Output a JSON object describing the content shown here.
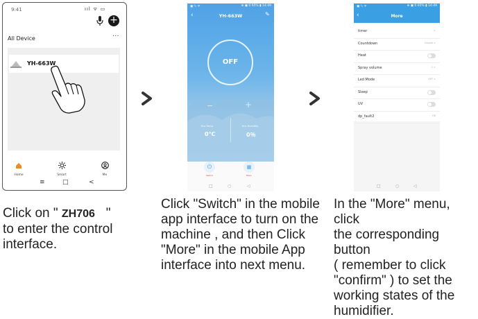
{
  "phone1": {
    "time": "9:41",
    "signal": "ııl ᯤ ▭",
    "header": "All Device",
    "more_dots": "···",
    "device_name": "YH-663W",
    "nav": [
      "Home",
      "Smart",
      "Me"
    ],
    "sysnav": [
      "≡",
      "□",
      "<"
    ]
  },
  "phone2": {
    "status_left": "▣ ⁰ᵢₗ ᯤ",
    "status_right": "⊛ ▣ 0 65% ▮ 14:49",
    "title": "YH-663W",
    "power_state": "OFF",
    "minus": "−",
    "plus": "+",
    "env_temp_label": "Env Temp",
    "env_temp_value": "0℃",
    "env_humidity_label": "Env Humidity",
    "env_humidity_value": "0％",
    "switch_label": "Switch",
    "more_label": "More",
    "sysnav": [
      "□",
      "○",
      "◁"
    ]
  },
  "phone3": {
    "status_left": "▣ ⁰ᵢₗ ᯤ",
    "status_right": "⊛ ▣ 0 65% ▮ 14:49",
    "title": "More",
    "rows": [
      {
        "label": "timer",
        "value": ">"
      },
      {
        "label": "Countdown",
        "value": "Cancel >"
      },
      {
        "label": "Heat",
        "value": ""
      },
      {
        "label": "Spray volume",
        "value": "1 >"
      },
      {
        "label": "Led Mode",
        "value": "OFF >"
      },
      {
        "label": "Sleep",
        "value": ""
      },
      {
        "label": "UV",
        "value": ""
      },
      {
        "label": "dp_fault2",
        "value": "OK"
      }
    ],
    "sysnav": [
      "□",
      "○",
      "◁"
    ]
  },
  "captions": {
    "c1_line1_a": "Click on \" ",
    "c1_line1_code": "ZH706",
    "c1_line1_b": "   \"",
    "c1_line2": "to enter the control",
    "c1_line3": "interface.",
    "c2": [
      "Click \"Switch\" in the mobile",
      "app interface to turn on the",
      "machine , and then Click",
      "\"More\" in the mobile App",
      "interface into next menu."
    ],
    "c3": [
      "In the \"More\" menu, click",
      "the corresponding button",
      "( remember to click",
      "\"confirm\" ) to set the",
      "working states of the",
      "humidifier."
    ]
  },
  "colors": {
    "accent_orange": "#f08a24",
    "app_blue": "#3b9fe3",
    "switch_red": "#e53935"
  }
}
